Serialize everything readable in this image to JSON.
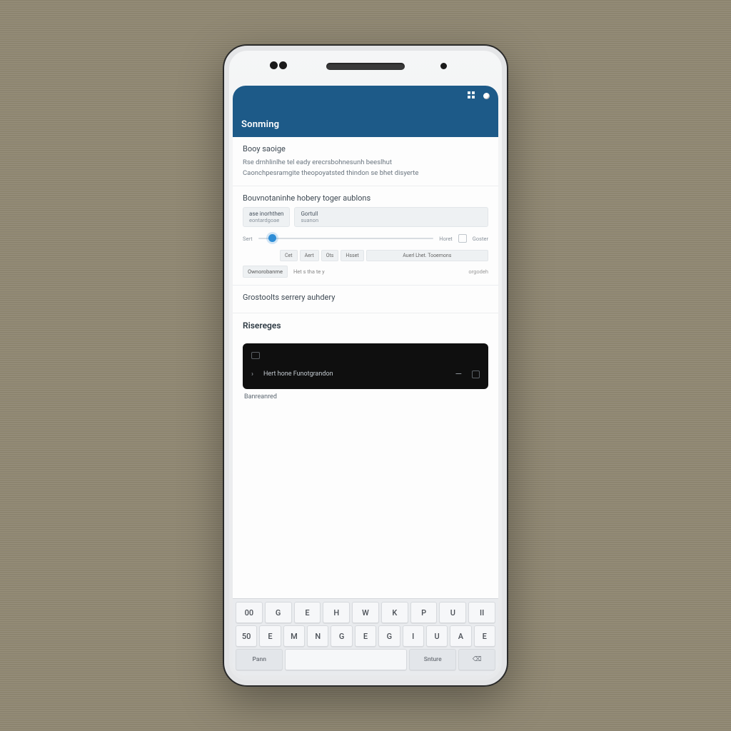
{
  "appbar": {
    "title": "Sonming",
    "grid_icon": "grid-icon",
    "dot_icon": "dot-icon"
  },
  "intro": {
    "heading": "Booy saoige",
    "line1": "Rse drnhlinlhe tel eady erecrsbohnesunh beeslhut",
    "line2": "Caonchpesramgite theopoyatsted thindon se bhet disyerte"
  },
  "options": {
    "heading": "Bouvnotaninhe hobery toger aublons",
    "chip1_l1": "ase inorhthen",
    "chip1_l2": "eontardgoae",
    "chip2_l1": "Gortull",
    "chip2_l2": "suanon",
    "slider_label": "Sert",
    "slider_after": "Horet",
    "slider_after2": "Goster",
    "seg1": "Cet",
    "seg2": "Aert",
    "seg3": "Ots",
    "seg4": "Hsset",
    "seg5": "Auerl Lhet. Tooemons",
    "inline_chip": "Ownorobanme",
    "inline_text": "Het s tha te y",
    "inline_right": "orgodeh"
  },
  "activity": {
    "heading": "Grostoolts serrery auhdery"
  },
  "resources": {
    "heading": "Risereges",
    "card_text": "Hert hone Funotgrandon",
    "note": "Banreanred"
  },
  "keyboard": {
    "row1": [
      "00",
      "G",
      "E",
      "H",
      "W",
      "K",
      "P",
      "U",
      "II"
    ],
    "row2": [
      "50",
      "E",
      "M",
      "N",
      "G",
      "E",
      "G",
      "I",
      "U",
      "A",
      "E"
    ],
    "row3_left": "Pann",
    "row3_space": "",
    "row3_right1": "Snture",
    "row3_right2": "⌫"
  }
}
